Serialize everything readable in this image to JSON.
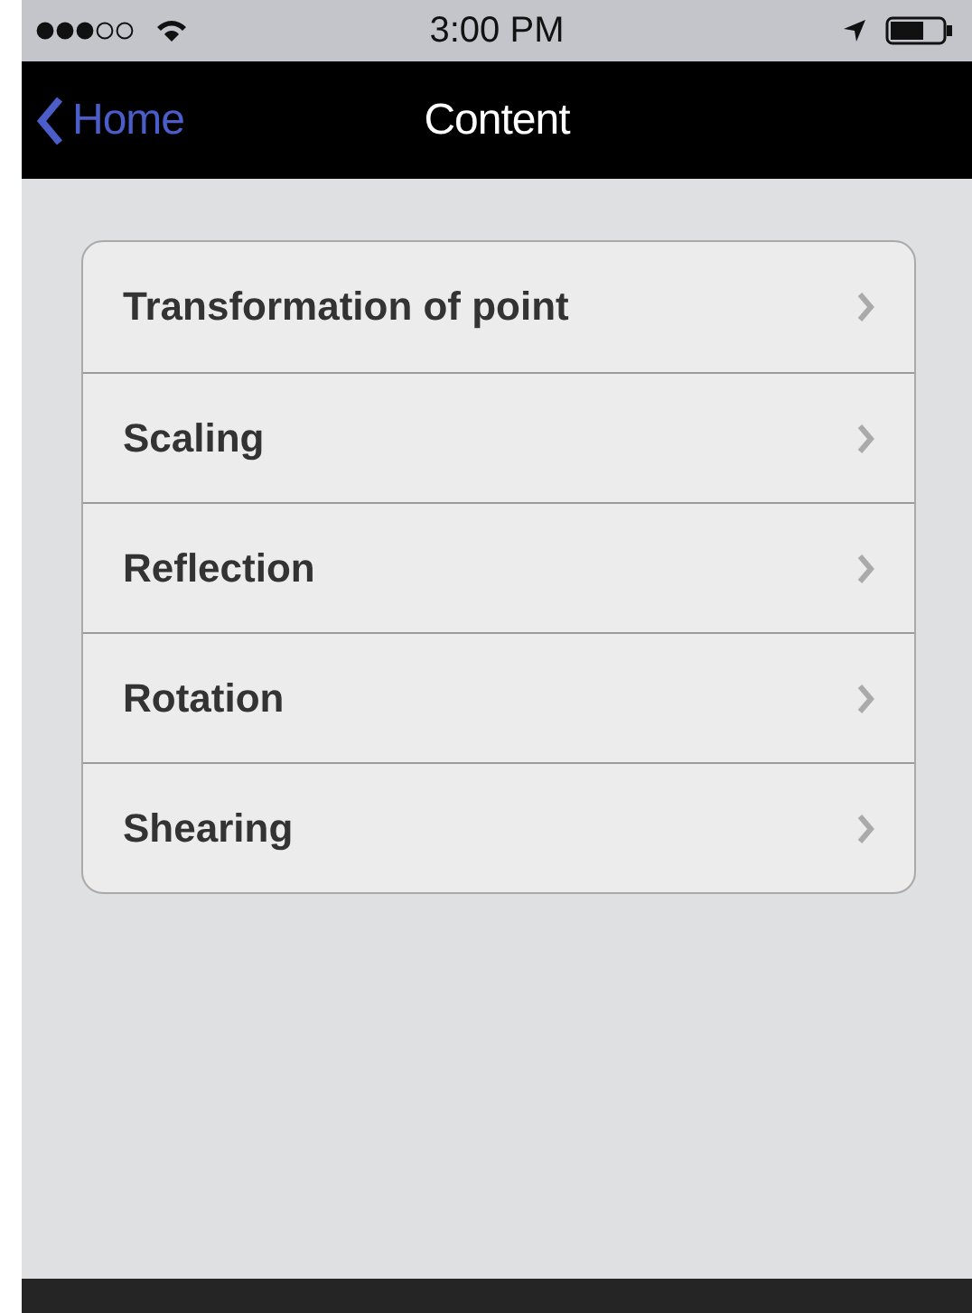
{
  "status_bar": {
    "time": "3:00 PM"
  },
  "nav_bar": {
    "back": "Home",
    "title": "Content"
  },
  "menu": {
    "items": [
      {
        "label": "Transformation of point"
      },
      {
        "label": "Scaling"
      },
      {
        "label": "Reflection"
      },
      {
        "label": "Rotation"
      },
      {
        "label": "Shearing"
      }
    ]
  }
}
